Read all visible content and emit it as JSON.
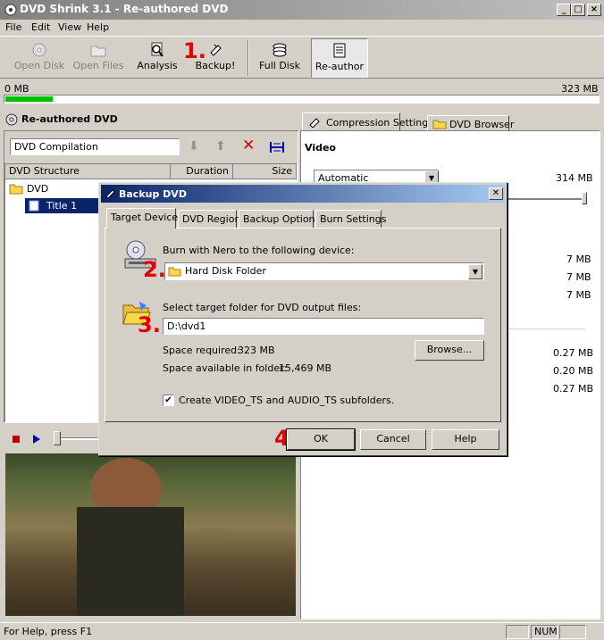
{
  "window": {
    "title": "DVD Shrink 3.1 - Re-authored DVD",
    "min": "_",
    "max": "□",
    "close": "×"
  },
  "menu": [
    "File",
    "Edit",
    "View",
    "Help"
  ],
  "toolbar": {
    "open_disk": "Open Disk",
    "open_files": "Open Files",
    "analysis": "Analysis",
    "backup": "Backup!",
    "full_disk": "Full Disk",
    "reauthor": "Re-author",
    "step1": "1."
  },
  "progress": {
    "left": "0 MB",
    "right": "323 MB",
    "fraction": 0.08
  },
  "left_panel": {
    "title": "Re-authored DVD",
    "compilation_name": "DVD Compilation",
    "columns": [
      "DVD Structure",
      "Duration",
      "Size"
    ],
    "tree": [
      {
        "label": "DVD"
      },
      {
        "label": "Title 1"
      }
    ]
  },
  "right_panel": {
    "tabs": [
      "Compression Settings",
      "DVD Browser"
    ],
    "section": "Video",
    "video_mode": "Automatic",
    "video_size": "314 MB",
    "values": [
      "7 MB",
      "7 MB",
      "7 MB",
      "0.27 MB",
      "0.20 MB",
      "0.27 MB"
    ]
  },
  "dialog": {
    "title": "Backup DVD",
    "tabs": [
      "Target Device",
      "DVD Region",
      "Backup Options",
      "Burn Settings"
    ],
    "burn_label": "Burn with Nero to the following device:",
    "device": "Hard Disk Folder",
    "folder_label": "Select target folder for DVD output files:",
    "folder": "D:\\dvd1",
    "space_required_label": "Space required:",
    "space_required": "323 MB",
    "space_available_label": "Space available in folder:",
    "space_available": "15,469 MB",
    "browse": "Browse...",
    "checkbox_label": "Create VIDEO_TS and AUDIO_TS subfolders.",
    "checkbox_checked": "✔",
    "ok": "OK",
    "cancel": "Cancel",
    "help": "Help",
    "step2": "2.",
    "step3": "3.",
    "step4": "4."
  },
  "status": {
    "help_text": "For Help, press F1",
    "num": "NUM"
  }
}
